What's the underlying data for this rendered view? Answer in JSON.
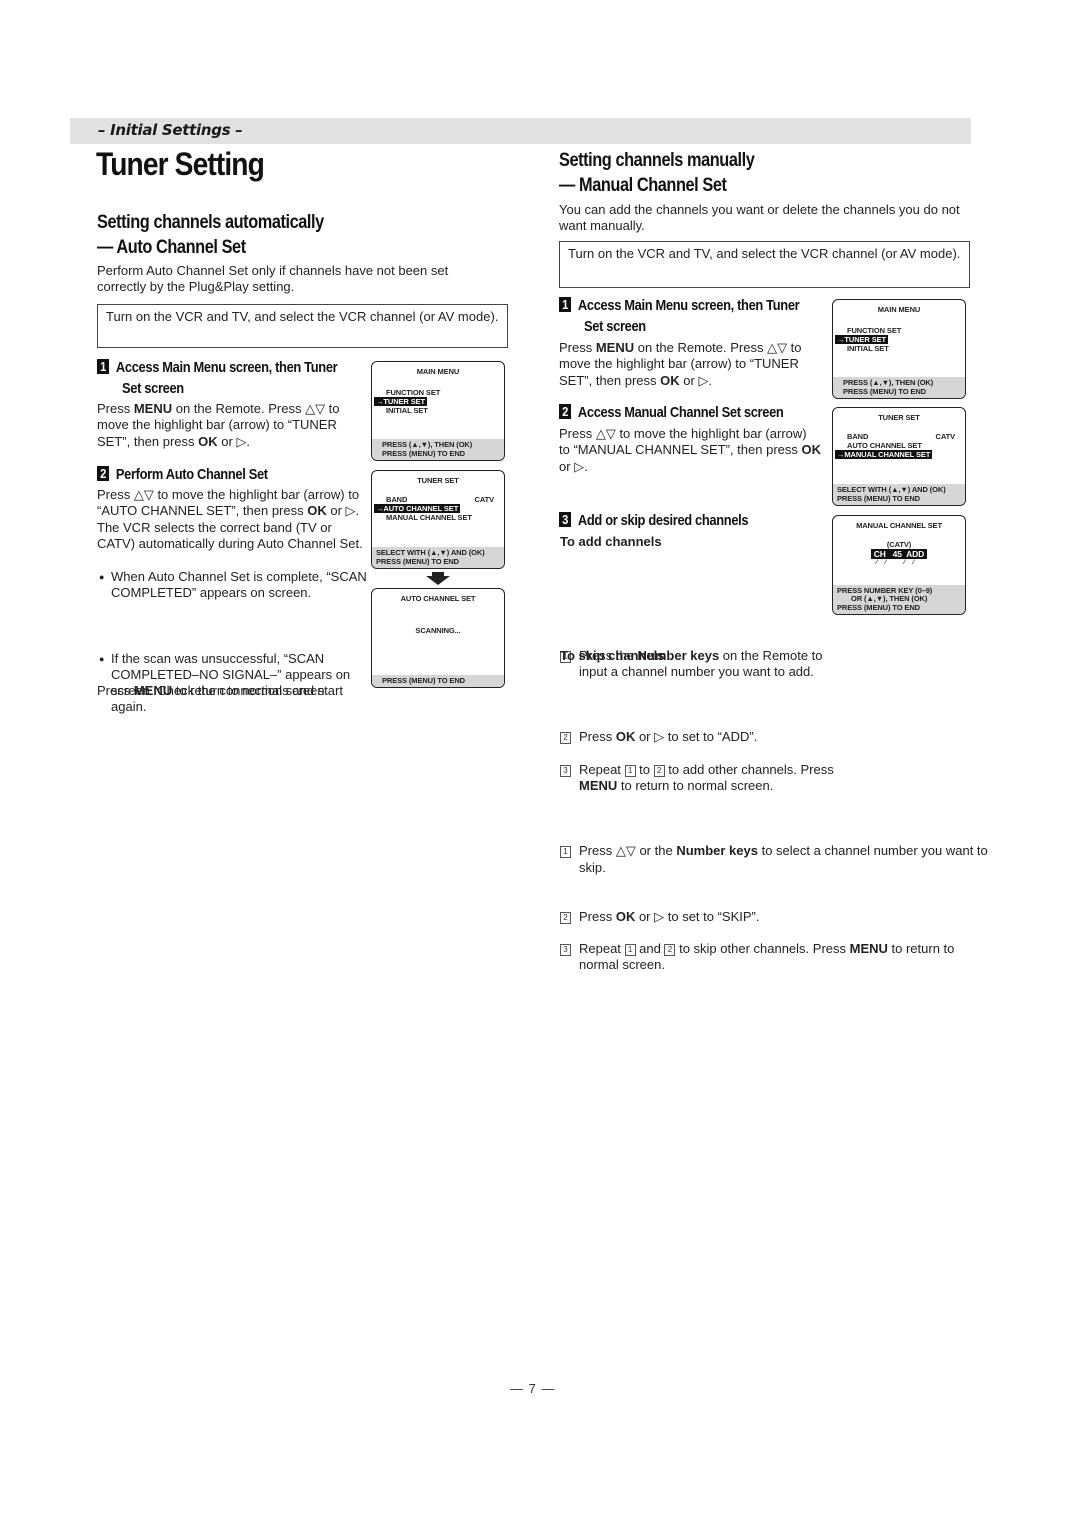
{
  "section_band": "– Initial Settings –",
  "page_title": "Tuner Setting",
  "auto": {
    "heading_line1": "Setting channels automatically",
    "heading_line2": "— Auto Channel Set",
    "intro": "Perform Auto Channel Set only if channels have not been set correctly by the Plug&Play setting.",
    "note": "Turn on the VCR and TV, and select the VCR channel (or AV mode).",
    "step1": {
      "number": "1",
      "heading_line1": "Access Main Menu screen, then Tuner",
      "heading_line2": "Set screen",
      "t1": "Press ",
      "b1": "MENU",
      "t2": " on the Remote. Press △▽ to move the highlight bar (arrow) to “TUNER SET”, then press ",
      "b2": "OK",
      "t3": " or ▷."
    },
    "step2": {
      "number": "2",
      "heading": "Perform Auto Channel Set",
      "t1": "Press △▽ to move the highlight bar (arrow) to “AUTO CHANNEL SET”, then press ",
      "b1": "OK",
      "t2": " or ▷. The VCR selects the correct band (TV or CATV) automatically during Auto Channel Set.",
      "bullets": [
        "When Auto Channel Set is complete, “SCAN COMPLETED” appears on screen.",
        "If the scan was unsuccessful, “SCAN COMPLETED–NO SIGNAL–” appears on screen. Check the connections and start again."
      ],
      "end_t1": "Press ",
      "end_b": "MENU",
      "end_t2": " to return to normal screen."
    },
    "screens": {
      "main_menu": {
        "title": "MAIN MENU",
        "items": [
          "FUNCTION SET",
          "→TUNER SET",
          "INITIAL SET"
        ],
        "footer": [
          "PRESS (▲,▼), THEN (OK)",
          "PRESS (MENU) TO END"
        ]
      },
      "tuner_set": {
        "title": "TUNER SET",
        "band_label": "BAND",
        "band_value": "CATV",
        "items": [
          "→AUTO CHANNEL SET",
          "MANUAL CHANNEL SET"
        ],
        "footer": [
          "SELECT WITH (▲,▼) AND (OK)",
          "PRESS (MENU) TO END"
        ]
      },
      "auto_channel_set": {
        "title": "AUTO CHANNEL SET",
        "status": "SCANNING...",
        "footer": [
          "PRESS (MENU) TO END"
        ]
      }
    }
  },
  "manual": {
    "heading_line1": "Setting channels manually",
    "heading_line2": "— Manual Channel Set",
    "intro": "You can add the channels you want or delete the channels you do not want manually.",
    "note": "Turn on the VCR and TV, and select the VCR channel (or AV mode).",
    "step1": {
      "number": "1",
      "heading_line1": "Access Main Menu screen, then Tuner",
      "heading_line2": "Set screen",
      "t1": "Press ",
      "b1": "MENU",
      "t2": " on the Remote. Press △▽ to move the highlight bar (arrow) to “TUNER SET”, then press ",
      "b2": "OK",
      "t3": " or ▷."
    },
    "step2": {
      "number": "2",
      "heading": "Access Manual Channel Set screen",
      "t1": "Press △▽ to move the highlight bar (arrow) to “MANUAL CHANNEL SET”, then press ",
      "b1": "OK",
      "t2": " or ▷."
    },
    "step3": {
      "number": "3",
      "heading": "Add or skip desired channels",
      "add_heading": "To add channels",
      "add_items": [
        {
          "n": "1",
          "t1": "Press the ",
          "b": "Number keys",
          "t2": " on the Remote to input a channel number you want to add."
        },
        {
          "n": "2",
          "t1": "Press ",
          "b": "OK",
          "t2": " or ▷ to set to “ADD”."
        },
        {
          "n": "3",
          "t1": "Repeat ",
          "r1": "1",
          "mid": " to ",
          "r2": "2",
          "t2": " to add other channels. Press ",
          "b": "MENU",
          "t3": " to return to normal screen."
        }
      ],
      "skip_heading": "To skip channels",
      "skip_items": [
        {
          "n": "1",
          "t1": "Press △▽ or the ",
          "b": "Number keys",
          "t2": " to select a channel number you want to skip."
        },
        {
          "n": "2",
          "t1": "Press ",
          "b": "OK",
          "t2": " or ▷ to set to “SKIP”."
        },
        {
          "n": "3",
          "t1": "Repeat ",
          "r1": "1",
          "mid": " and ",
          "r2": "2",
          "t2": " to skip other channels. Press ",
          "b": "MENU",
          "t3": " to return to normal screen."
        }
      ]
    },
    "screens": {
      "main_menu": {
        "title": "MAIN MENU",
        "items": [
          "FUNCTION SET",
          "→TUNER SET",
          "INITIAL SET"
        ],
        "footer": [
          "PRESS (▲,▼), THEN (OK)",
          "PRESS (MENU) TO END"
        ]
      },
      "tuner_set": {
        "title": "TUNER SET",
        "band_label": "BAND",
        "band_value": "CATV",
        "items": [
          "AUTO CHANNEL SET",
          "→MANUAL CHANNEL SET"
        ],
        "footer": [
          "SELECT WITH (▲,▼) AND (OK)",
          "PRESS (MENU) TO END"
        ]
      },
      "manual_channel_set": {
        "title": "MANUAL CHANNEL SET",
        "band": "(CATV)",
        "channel_row": "CH   45  ADD",
        "footer": [
          "PRESS NUMBER KEY (0–9)",
          "OR (▲,▼), THEN (OK)",
          "PRESS (MENU) TO END"
        ]
      }
    }
  },
  "page_number": "— 7 —"
}
